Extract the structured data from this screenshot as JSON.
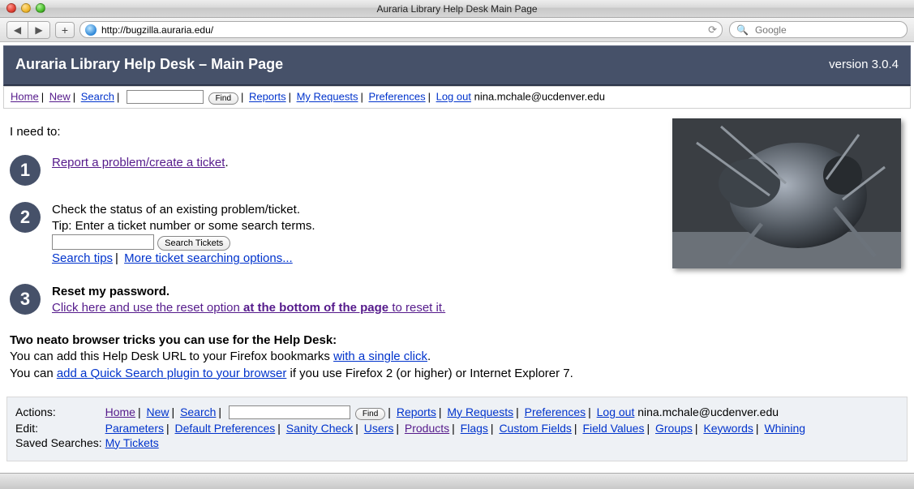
{
  "window": {
    "title": "Auraria Library Help Desk Main Page",
    "url": "http://bugzilla.auraria.edu/",
    "search_placeholder": "Google"
  },
  "header": {
    "title": "Auraria Library Help Desk – Main Page",
    "version": "version 3.0.4"
  },
  "topnav": {
    "home": "Home",
    "new": "New",
    "search": "Search",
    "find": "Find",
    "reports": "Reports",
    "my_requests": "My Requests",
    "preferences": "Preferences",
    "logout": "Log out",
    "user_email": "nina.mchale@ucdenver.edu"
  },
  "need_heading": "I need to:",
  "options": {
    "n1": "1",
    "n2": "2",
    "n3": "3",
    "opt1_link": "Report a problem/create a ticket",
    "opt2_line1": "Check the status of an existing problem/ticket.",
    "opt2_line2": "Tip: Enter a ticket number or some search terms.",
    "opt2_btn": "Search Tickets",
    "opt2_tips": "Search tips",
    "opt2_more": "More ticket searching options...",
    "opt3_head": "Reset my password.",
    "opt3_link_pre": "Click here and use the reset option ",
    "opt3_link_bold": "at the bottom of the page",
    "opt3_link_post": " to reset it."
  },
  "tricks": {
    "heading": "Two neato browser tricks you can use for the Help Desk:",
    "line1_pre": "You can add this Help Desk URL to your Firefox bookmarks ",
    "line1_link": "with a single click",
    "line2_pre": "You can ",
    "line2_link": "add a Quick Search plugin to your browser",
    "line2_post": " if you use Firefox 2 (or higher) or Internet Explorer 7."
  },
  "footer": {
    "label_actions": "Actions:",
    "label_edit": "Edit:",
    "label_saved": "Saved Searches:",
    "actions": {
      "home": "Home",
      "new": "New",
      "search": "Search",
      "find": "Find",
      "reports": "Reports",
      "my_requests": "My Requests",
      "preferences": "Preferences",
      "logout": "Log out",
      "user_email": "nina.mchale@ucdenver.edu"
    },
    "edit": {
      "parameters": "Parameters",
      "default_prefs": "Default Preferences",
      "sanity": "Sanity Check",
      "users": "Users",
      "products": "Products",
      "flags": "Flags",
      "custom_fields": "Custom Fields",
      "field_values": "Field Values",
      "groups": "Groups",
      "keywords": "Keywords",
      "whining": "Whining"
    },
    "saved": {
      "my_tickets": "My Tickets"
    }
  }
}
